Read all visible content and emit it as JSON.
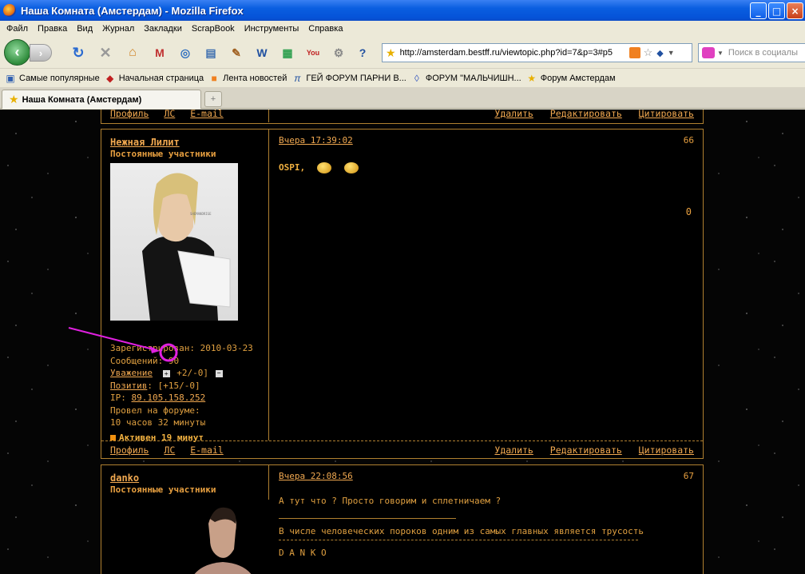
{
  "window": {
    "title": "Наша Комната (Амстердам) - Mozilla Firefox"
  },
  "menu": [
    "Файл",
    "Правка",
    "Вид",
    "Журнал",
    "Закладки",
    "ScrapBook",
    "Инструменты",
    "Справка"
  ],
  "nav": {
    "url": "http://amsterdam.bestff.ru/viewtopic.php?id=7&p=3#p5",
    "search_placeholder": "Поиск в социалы"
  },
  "bookmarks": [
    {
      "label": "Самые популярные",
      "icon": "bookmarks-folder-icon"
    },
    {
      "label": "Начальная страница",
      "icon": "home-page-icon"
    },
    {
      "label": "Лента новостей",
      "icon": "rss-icon"
    },
    {
      "label": "ГЕЙ ФОРУМ ПАРНИ В...",
      "icon": "forum-pi-icon"
    },
    {
      "label": "ФОРУМ \"МАЛЬЧИШН...",
      "icon": "forum-badge-icon"
    },
    {
      "label": "Форум Амстердам",
      "icon": "star-icon"
    }
  ],
  "tab": {
    "label": "Наша Комната (Амстердам)"
  },
  "top_footer": {
    "left": [
      "Профиль",
      "ЛС",
      "E-mail"
    ],
    "right": [
      "Удалить",
      "Редактировать",
      "Цитировать"
    ]
  },
  "post1": {
    "author": "Нежная Лилит",
    "rank": "Постоянные участники",
    "registered": "Зарегистрирован: 2010-03-23",
    "messages": "Сообщений: 90",
    "respect_label": "Уважение",
    "respect_value": "+2/-0]",
    "positive_label": "Позитив",
    "positive_value": ": [+15/-0]",
    "ip_label": "IP: ",
    "ip": "89.105.158.252",
    "time_label": "Провел на форуме:",
    "time_value": "10 часов 32 минуты",
    "active": "Активен 19 минут",
    "date": "Вчера 17:39:02",
    "number": "66",
    "text": "OSPI,",
    "rating": "0",
    "footer_left": [
      "Профиль",
      "ЛС",
      "E-mail"
    ],
    "footer_right": [
      "Удалить",
      "Редактировать",
      "Цитировать"
    ]
  },
  "post2": {
    "author": "danko",
    "rank": "Постоянные участники",
    "date": "Вчера 22:08:56",
    "number": "67",
    "text": "А тут что ? Просто говорим и сплетничаем ?",
    "signature": "В числе человеческих пороков одним из самых главных является трусость",
    "signature_name": "D A N K O"
  },
  "colors": {
    "accent": "#e8a040",
    "link": "#f0a850",
    "annotation": "#e020e0"
  }
}
